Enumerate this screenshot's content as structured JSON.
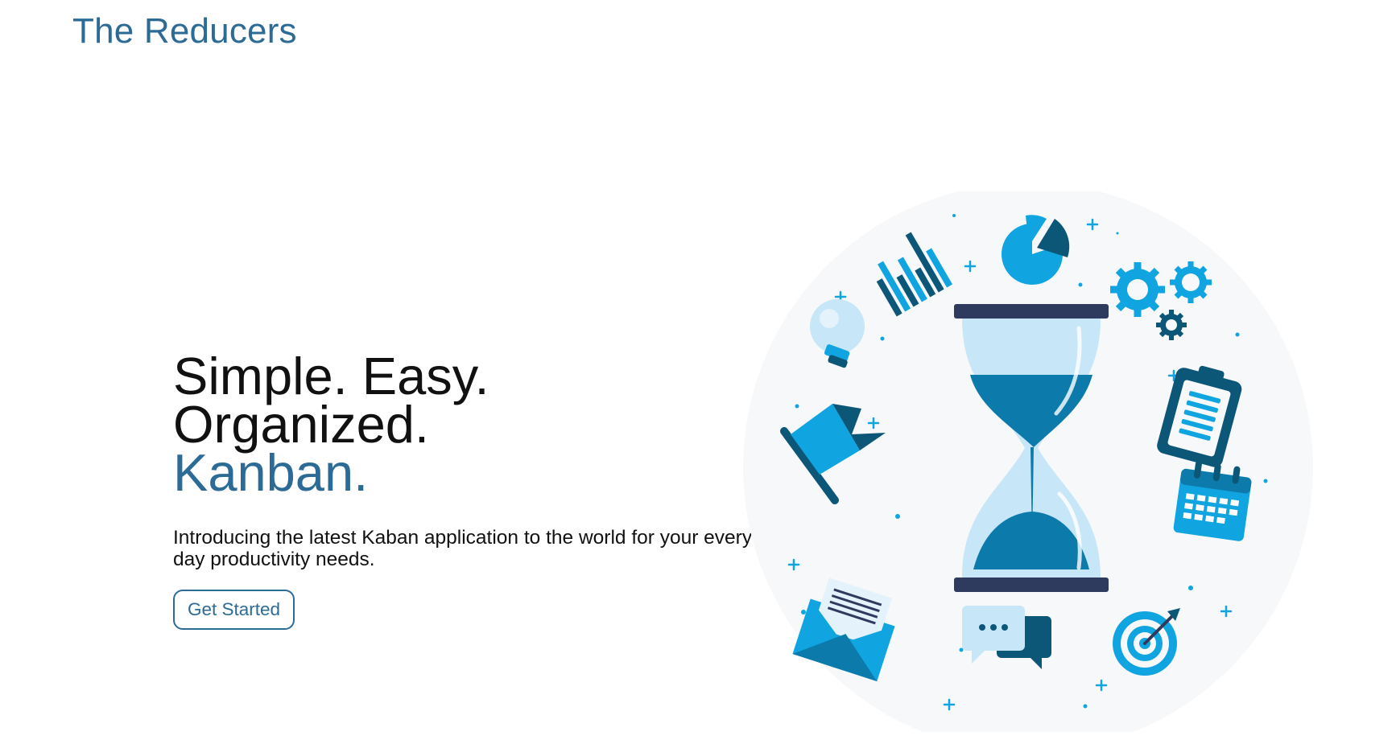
{
  "header": {
    "brand": "The Reducers"
  },
  "hero": {
    "headline": "Simple. Easy. Organized.",
    "headline_accent": "Kanban.",
    "intro": "Introducing the latest Kaban application to the world for your every day productivity needs.",
    "cta_label": "Get Started"
  },
  "colors": {
    "brand_blue": "#2d6b97",
    "illustration_primary": "#10a4e0",
    "illustration_dark": "#0c5677",
    "illustration_navy": "#2e3a5e",
    "illustration_light": "#c7e6f7",
    "illustration_bg": "#f7f8f9"
  }
}
